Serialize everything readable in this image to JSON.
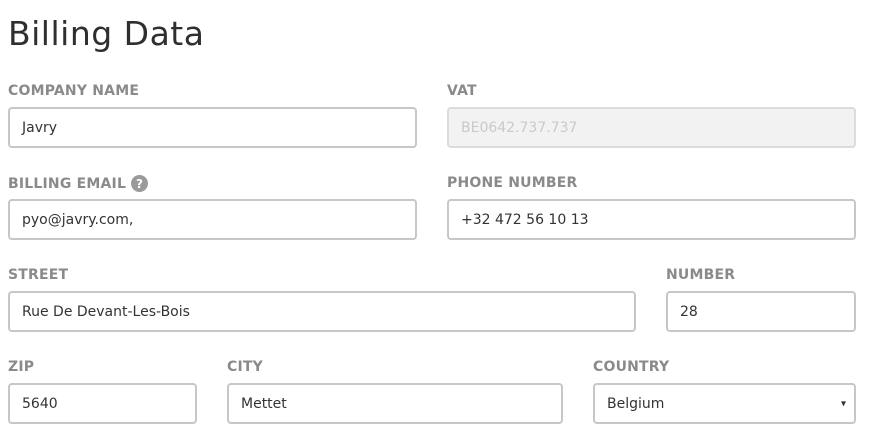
{
  "page": {
    "title": "Billing Data"
  },
  "company_name": {
    "label": "COMPANY NAME",
    "value": "Javry"
  },
  "vat": {
    "label": "VAT",
    "value": "BE0642.737.737"
  },
  "billing_email": {
    "label": "BILLING EMAIL",
    "help": "?",
    "value": "pyo@javry.com,"
  },
  "phone_number": {
    "label": "PHONE NUMBER",
    "value": "+32 472 56 10 13"
  },
  "street": {
    "label": "STREET",
    "value": "Rue De Devant-Les-Bois"
  },
  "number": {
    "label": "NUMBER",
    "value": "28"
  },
  "zip": {
    "label": "ZIP",
    "value": "5640"
  },
  "city": {
    "label": "CITY",
    "value": "Mettet"
  },
  "country": {
    "label": "COUNTRY",
    "value": "Belgium",
    "arrow": "▾"
  }
}
